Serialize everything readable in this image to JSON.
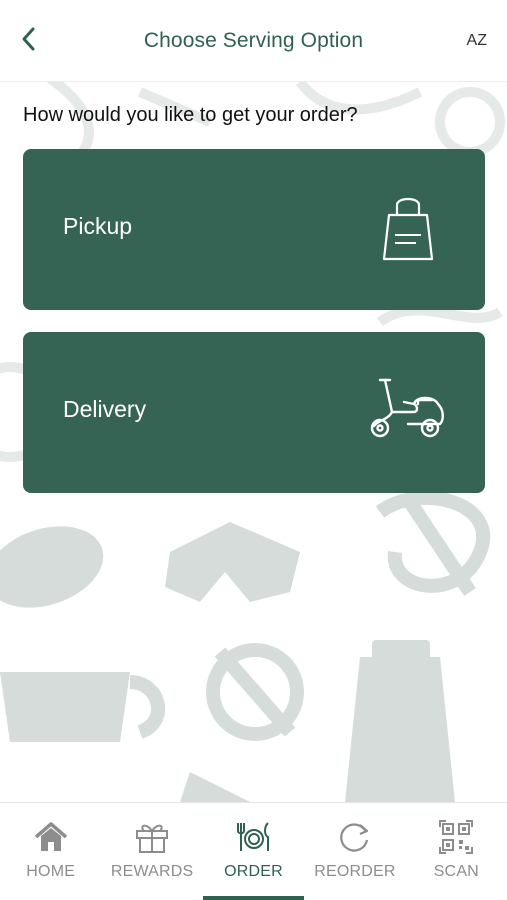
{
  "header": {
    "title": "Choose Serving Option",
    "language": "AZ"
  },
  "main": {
    "question": "How would you like to get your order?",
    "options": [
      {
        "label": "Pickup",
        "icon": "shopping-bag-icon"
      },
      {
        "label": "Delivery",
        "icon": "scooter-icon"
      }
    ]
  },
  "bottom_nav": {
    "items": [
      {
        "label": "HOME",
        "icon": "home-icon",
        "active": false
      },
      {
        "label": "REWARDS",
        "icon": "gift-icon",
        "active": false
      },
      {
        "label": "ORDER",
        "icon": "cutlery-icon",
        "active": true
      },
      {
        "label": "REORDER",
        "icon": "refresh-icon",
        "active": false
      },
      {
        "label": "SCAN",
        "icon": "qr-code-icon",
        "active": false
      }
    ]
  },
  "colors": {
    "accent": "#2f6152",
    "card": "#366454",
    "inactive": "#8d8d8d",
    "pattern": "#cfd6d3"
  }
}
